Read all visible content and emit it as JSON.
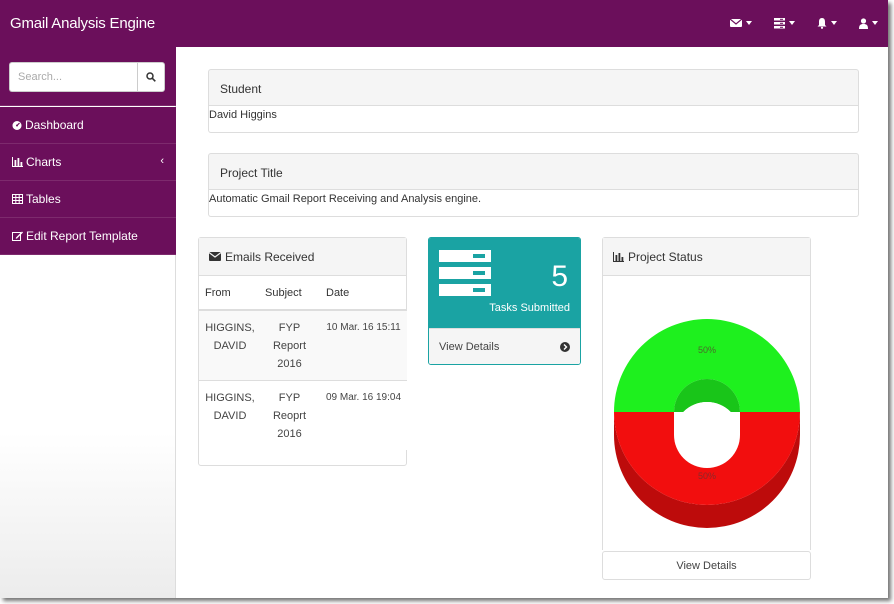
{
  "app": {
    "title": "Gmail Analysis Engine"
  },
  "navbar": {
    "icons": [
      "envelope-icon",
      "tasks-icon",
      "bell-icon",
      "user-icon"
    ]
  },
  "sidebar": {
    "search_placeholder": "Search...",
    "items": [
      {
        "label": "Dashboard",
        "icon": "dashboard-icon"
      },
      {
        "label": "Charts",
        "icon": "bar-chart-icon"
      },
      {
        "label": "Tables",
        "icon": "table-icon"
      },
      {
        "label": "Edit Report Template",
        "icon": "edit-icon"
      }
    ]
  },
  "student": {
    "label": "Student",
    "value": "David Higgins"
  },
  "project": {
    "label": "Project Title",
    "value": "Automatic Gmail Report Receiving and Analysis engine."
  },
  "emails": {
    "title": "Emails Received",
    "columns": [
      "From",
      "Subject",
      "Date"
    ],
    "rows": [
      {
        "from": "HIGGINS, DAVID",
        "subject": "FYP Report 2016",
        "date": "10 Mar. 16 15:11"
      },
      {
        "from": "HIGGINS, DAVID",
        "subject": "FYP Reoprt 2016",
        "date": "09 Mar. 16 19:04"
      }
    ]
  },
  "tasks": {
    "count": "5",
    "label": "Tasks Submitted",
    "link": "View Details"
  },
  "project_status": {
    "title": "Project Status",
    "link": "View Details",
    "slices": [
      {
        "label": "50%",
        "value": 50,
        "color": "#1ef01e"
      },
      {
        "label": "50%",
        "value": 50,
        "color": "#f20e0e"
      }
    ]
  },
  "colors": {
    "brand": "#6b0f5b",
    "teal": "#1aa3a3"
  }
}
